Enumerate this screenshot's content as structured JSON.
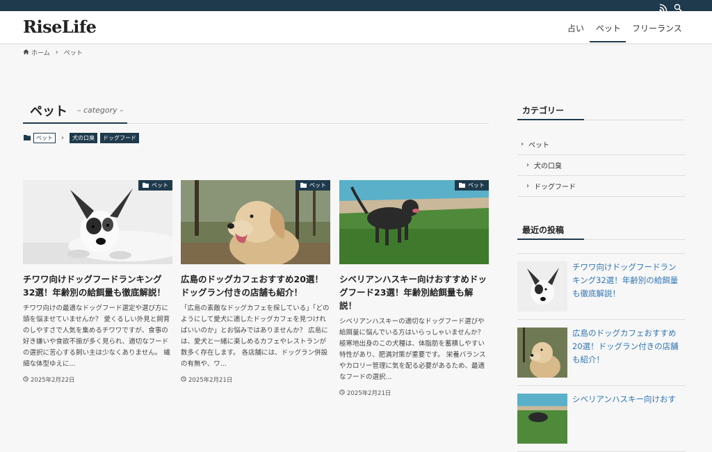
{
  "site": {
    "logo": "RiseLife"
  },
  "topbar": {
    "icons": [
      "rss-icon",
      "search-icon"
    ]
  },
  "nav": {
    "items": [
      "占い",
      "ペット",
      "フリーランス"
    ],
    "active": "ペット"
  },
  "breadcrumb": {
    "home": "ホーム",
    "current": "ペット"
  },
  "category": {
    "title": "ペット",
    "subtitle": "– category –",
    "tags": {
      "parent": "ペット",
      "children": [
        "犬の口臭",
        "ドッグフード"
      ]
    }
  },
  "posts": [
    {
      "badge": "ペット",
      "title": "チワワ向けドッグフードランキング32選！年齢別の給餌量も徹底解説！",
      "excerpt": "チワワ向けの最適なドッグフード選定や選び方に頭を悩ませていませんか？ 愛くるしい外見と飼育のしやすさで人気を集めるチワワですが、食事の好き嫌いや食欲不振が多く見られ、適切なフードの選択に苦心する飼い主は少なくありません。 繊細な体型ゆえに...",
      "date": "2025年2月22日"
    },
    {
      "badge": "ペット",
      "title": "広島のドッグカフェおすすめ20選！ドッグラン付きの店舗も紹介！",
      "excerpt": "「広島の素敵なドッグカフェを探している」「どのようにして愛犬に適したドッグカフェを見つければいいのか」とお悩みではありませんか？ 広島には、愛犬と一緒に楽しめるカフェやレストランが数多く存在します。 各店舗には、ドッグラン併設の有無や、ワ...",
      "date": "2025年2月21日"
    },
    {
      "badge": "ペット",
      "title": "シベリアンハスキー向けおすすめドッグフード23選！年齢別給餌量も解説！",
      "excerpt": "シベリアンハスキーの適切なドッグフード選びや給餌量に悩んでいる方はいらっしゃいませんか？ 極寒地出身のこの犬種は、体脂肪を蓄積しやすい特性があり、肥満対策が重要です。 栄養バランスやカロリー管理に気を配る必要があるため、最適なフードの選択...",
      "date": "2025年2月21日"
    }
  ],
  "sidebar": {
    "categories_title": "カテゴリー",
    "categories": [
      {
        "label": "ペット",
        "level": 0
      },
      {
        "label": "犬の口臭",
        "level": 1
      },
      {
        "label": "ドッグフード",
        "level": 1
      }
    ],
    "recent_title": "最近の投稿",
    "recent": [
      {
        "title": "チワワ向けドッグフードランキング32選！年齢別の給餌量も徹底解説！"
      },
      {
        "title": "広島のドッグカフェおすすめ20選！ドッグラン付きの店舗も紹介！"
      },
      {
        "title": "シベリアンハスキー向けおす"
      }
    ]
  },
  "colors": {
    "accent": "#1e3a4c",
    "link": "#2f75b5",
    "background": "#f7f7f7"
  }
}
